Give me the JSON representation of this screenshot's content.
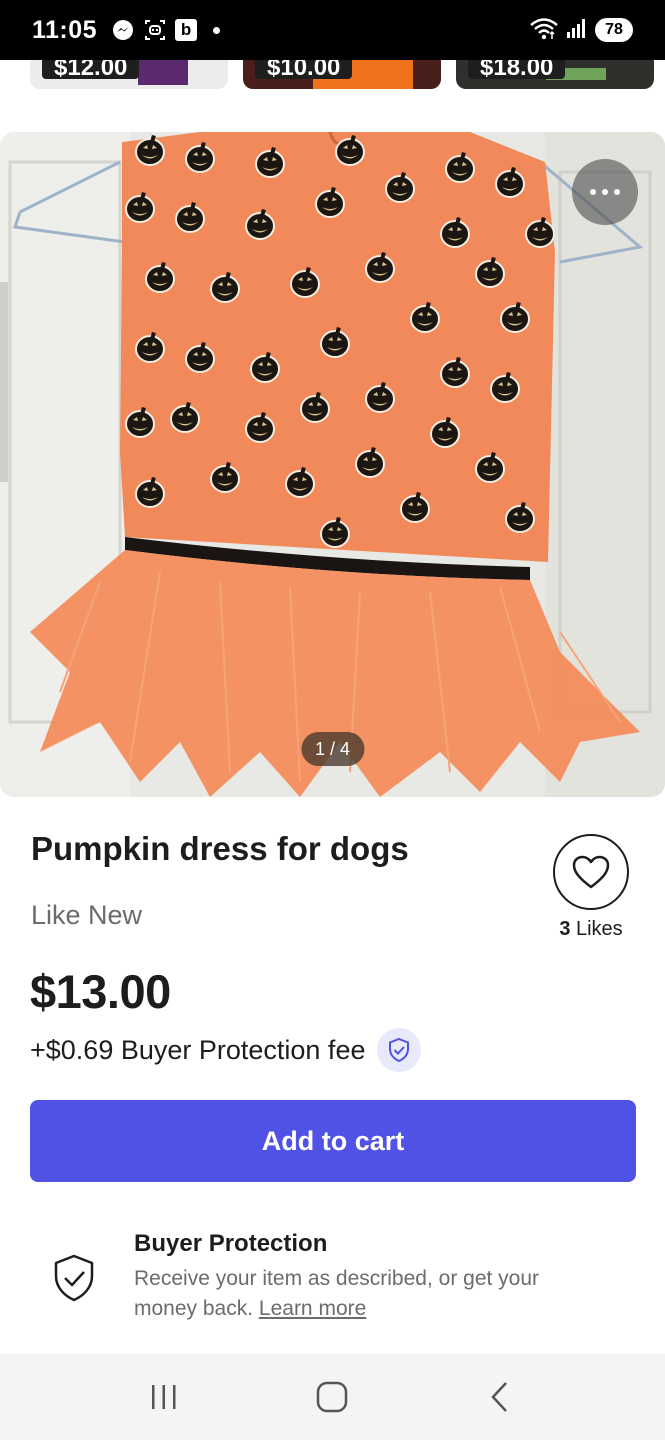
{
  "status_bar": {
    "time": "11:05",
    "battery": "78",
    "left_icons": [
      "messenger-icon",
      "assistant-icon",
      "b-app-icon",
      "notification-dot"
    ],
    "right_icons": [
      "wifi-icon",
      "signal-icon",
      "battery-icon"
    ]
  },
  "related_items": [
    {
      "price": "$12.00"
    },
    {
      "price": "$10.00"
    },
    {
      "price": "$18.00"
    }
  ],
  "gallery": {
    "counter": "1 / 4",
    "more_icon": "more-horizontal-icon"
  },
  "listing": {
    "title": "Pumpkin dress for dogs",
    "condition": "Like New",
    "likes_count": "3",
    "likes_label": " Likes",
    "price": "$13.00",
    "fee": "+$0.69 Buyer Protection fee",
    "cart_label": "Add to cart"
  },
  "buyer_protection": {
    "title": "Buyer Protection",
    "text": "Receive your item as described, or get your money back. ",
    "link": "Learn more"
  },
  "colors": {
    "accent": "#4f52e4",
    "dress": "#f08a58",
    "text": "#1d1d1f",
    "muted": "#6b6b70"
  },
  "nav": [
    "recent-apps-icon",
    "home-icon",
    "back-icon"
  ]
}
